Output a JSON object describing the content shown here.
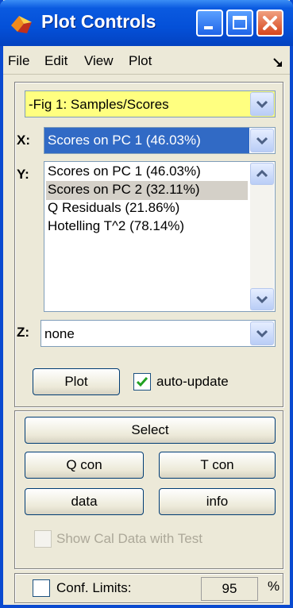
{
  "window": {
    "title": "Plot Controls"
  },
  "menu": {
    "items": [
      "File",
      "Edit",
      "View",
      "Plot"
    ]
  },
  "figure_selector": {
    "value": "-Fig 1: Samples/Scores"
  },
  "x_axis": {
    "label": "X:",
    "value": "Scores on PC 1 (46.03%)"
  },
  "y_axis": {
    "label": "Y:",
    "options": [
      "Scores on PC 1 (46.03%)",
      "Scores on PC 2 (32.11%)",
      "Q Residuals (21.86%)",
      "Hotelling T^2 (78.14%)"
    ],
    "selected_index": 1
  },
  "z_axis": {
    "label": "Z:",
    "value": "none"
  },
  "buttons": {
    "plot": "Plot",
    "select": "Select",
    "q_con": "Q con",
    "t_con": "T con",
    "data": "data",
    "info": "info"
  },
  "auto_update": {
    "label": "auto-update",
    "checked": true
  },
  "show_cal": {
    "label": "Show Cal Data with Test",
    "checked": false,
    "enabled": false
  },
  "conf_limits": {
    "label": "Conf. Limits:",
    "checked": false,
    "value": "95",
    "unit": "%"
  },
  "colors": {
    "title_bar": "#0450d8",
    "figure_selector_bg": "#ffff80",
    "selection": "#316ac5"
  }
}
